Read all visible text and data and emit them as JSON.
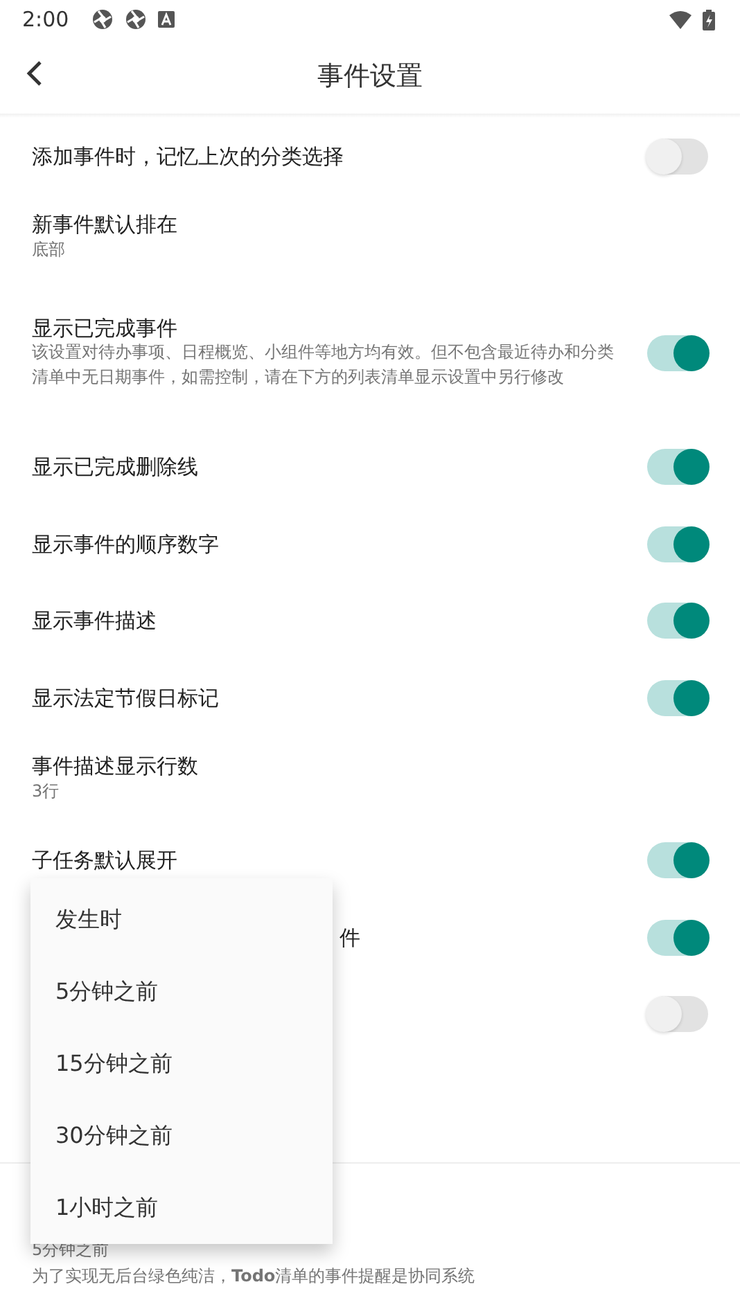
{
  "status_bar": {
    "time": "2:00"
  },
  "header": {
    "title": "事件设置"
  },
  "settings": [
    {
      "kind": "switch",
      "title": "添加事件时，记忆上次的分类选择",
      "on": false
    },
    {
      "kind": "value",
      "title": "新事件默认排在",
      "subtitle": "底部"
    },
    {
      "kind": "switch",
      "title": "显示已完成事件",
      "description": "该设置对待办事项、日程概览、小组件等地方均有效。但不包含最近待办和分类清单中无日期事件，如需控制，请在下方的列表清单显示设置中另行修改",
      "on": true
    },
    {
      "kind": "switch",
      "title": "显示已完成删除线",
      "on": true
    },
    {
      "kind": "switch",
      "title": "显示事件的顺序数字",
      "on": true
    },
    {
      "kind": "switch",
      "title": "显示事件描述",
      "on": true
    },
    {
      "kind": "switch",
      "title": "显示法定节假日标记",
      "on": true
    },
    {
      "kind": "value",
      "title": "事件描述显示行数",
      "subtitle": "3行"
    },
    {
      "kind": "switch",
      "title": "子任务默认展开",
      "on": true
    },
    {
      "kind": "switch",
      "title_tail": "件",
      "on": true
    },
    {
      "kind": "switch",
      "on": false
    },
    {
      "kind": "divider"
    },
    {
      "kind": "value",
      "subtitle": "5分钟之前",
      "description": "为了实现无后台绿色纯洁，**Todo**清单的事件提醒是协同系统"
    }
  ],
  "menu": {
    "items": [
      "发生时",
      "5分钟之前",
      "15分钟之前",
      "30分钟之前",
      "1小时之前"
    ]
  }
}
